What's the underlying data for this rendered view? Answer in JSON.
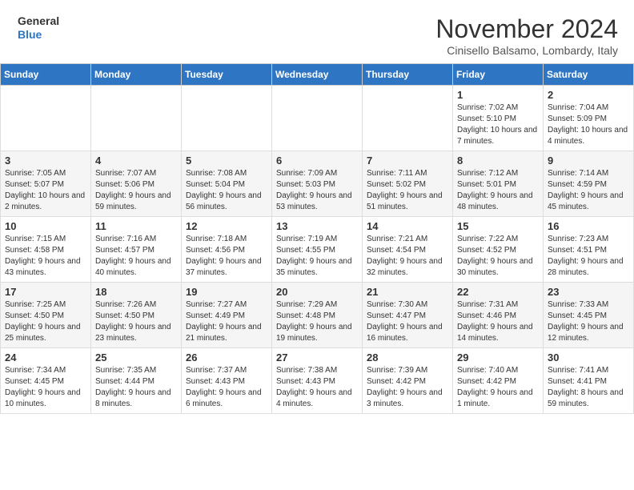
{
  "header": {
    "logo_line1": "General",
    "logo_line2": "Blue",
    "month": "November 2024",
    "location": "Cinisello Balsamo, Lombardy, Italy"
  },
  "weekdays": [
    "Sunday",
    "Monday",
    "Tuesday",
    "Wednesday",
    "Thursday",
    "Friday",
    "Saturday"
  ],
  "weeks": [
    [
      {
        "day": "",
        "info": ""
      },
      {
        "day": "",
        "info": ""
      },
      {
        "day": "",
        "info": ""
      },
      {
        "day": "",
        "info": ""
      },
      {
        "day": "",
        "info": ""
      },
      {
        "day": "1",
        "info": "Sunrise: 7:02 AM\nSunset: 5:10 PM\nDaylight: 10 hours and 7 minutes."
      },
      {
        "day": "2",
        "info": "Sunrise: 7:04 AM\nSunset: 5:09 PM\nDaylight: 10 hours and 4 minutes."
      }
    ],
    [
      {
        "day": "3",
        "info": "Sunrise: 7:05 AM\nSunset: 5:07 PM\nDaylight: 10 hours and 2 minutes."
      },
      {
        "day": "4",
        "info": "Sunrise: 7:07 AM\nSunset: 5:06 PM\nDaylight: 9 hours and 59 minutes."
      },
      {
        "day": "5",
        "info": "Sunrise: 7:08 AM\nSunset: 5:04 PM\nDaylight: 9 hours and 56 minutes."
      },
      {
        "day": "6",
        "info": "Sunrise: 7:09 AM\nSunset: 5:03 PM\nDaylight: 9 hours and 53 minutes."
      },
      {
        "day": "7",
        "info": "Sunrise: 7:11 AM\nSunset: 5:02 PM\nDaylight: 9 hours and 51 minutes."
      },
      {
        "day": "8",
        "info": "Sunrise: 7:12 AM\nSunset: 5:01 PM\nDaylight: 9 hours and 48 minutes."
      },
      {
        "day": "9",
        "info": "Sunrise: 7:14 AM\nSunset: 4:59 PM\nDaylight: 9 hours and 45 minutes."
      }
    ],
    [
      {
        "day": "10",
        "info": "Sunrise: 7:15 AM\nSunset: 4:58 PM\nDaylight: 9 hours and 43 minutes."
      },
      {
        "day": "11",
        "info": "Sunrise: 7:16 AM\nSunset: 4:57 PM\nDaylight: 9 hours and 40 minutes."
      },
      {
        "day": "12",
        "info": "Sunrise: 7:18 AM\nSunset: 4:56 PM\nDaylight: 9 hours and 37 minutes."
      },
      {
        "day": "13",
        "info": "Sunrise: 7:19 AM\nSunset: 4:55 PM\nDaylight: 9 hours and 35 minutes."
      },
      {
        "day": "14",
        "info": "Sunrise: 7:21 AM\nSunset: 4:54 PM\nDaylight: 9 hours and 32 minutes."
      },
      {
        "day": "15",
        "info": "Sunrise: 7:22 AM\nSunset: 4:52 PM\nDaylight: 9 hours and 30 minutes."
      },
      {
        "day": "16",
        "info": "Sunrise: 7:23 AM\nSunset: 4:51 PM\nDaylight: 9 hours and 28 minutes."
      }
    ],
    [
      {
        "day": "17",
        "info": "Sunrise: 7:25 AM\nSunset: 4:50 PM\nDaylight: 9 hours and 25 minutes."
      },
      {
        "day": "18",
        "info": "Sunrise: 7:26 AM\nSunset: 4:50 PM\nDaylight: 9 hours and 23 minutes."
      },
      {
        "day": "19",
        "info": "Sunrise: 7:27 AM\nSunset: 4:49 PM\nDaylight: 9 hours and 21 minutes."
      },
      {
        "day": "20",
        "info": "Sunrise: 7:29 AM\nSunset: 4:48 PM\nDaylight: 9 hours and 19 minutes."
      },
      {
        "day": "21",
        "info": "Sunrise: 7:30 AM\nSunset: 4:47 PM\nDaylight: 9 hours and 16 minutes."
      },
      {
        "day": "22",
        "info": "Sunrise: 7:31 AM\nSunset: 4:46 PM\nDaylight: 9 hours and 14 minutes."
      },
      {
        "day": "23",
        "info": "Sunrise: 7:33 AM\nSunset: 4:45 PM\nDaylight: 9 hours and 12 minutes."
      }
    ],
    [
      {
        "day": "24",
        "info": "Sunrise: 7:34 AM\nSunset: 4:45 PM\nDaylight: 9 hours and 10 minutes."
      },
      {
        "day": "25",
        "info": "Sunrise: 7:35 AM\nSunset: 4:44 PM\nDaylight: 9 hours and 8 minutes."
      },
      {
        "day": "26",
        "info": "Sunrise: 7:37 AM\nSunset: 4:43 PM\nDaylight: 9 hours and 6 minutes."
      },
      {
        "day": "27",
        "info": "Sunrise: 7:38 AM\nSunset: 4:43 PM\nDaylight: 9 hours and 4 minutes."
      },
      {
        "day": "28",
        "info": "Sunrise: 7:39 AM\nSunset: 4:42 PM\nDaylight: 9 hours and 3 minutes."
      },
      {
        "day": "29",
        "info": "Sunrise: 7:40 AM\nSunset: 4:42 PM\nDaylight: 9 hours and 1 minute."
      },
      {
        "day": "30",
        "info": "Sunrise: 7:41 AM\nSunset: 4:41 PM\nDaylight: 8 hours and 59 minutes."
      }
    ]
  ]
}
